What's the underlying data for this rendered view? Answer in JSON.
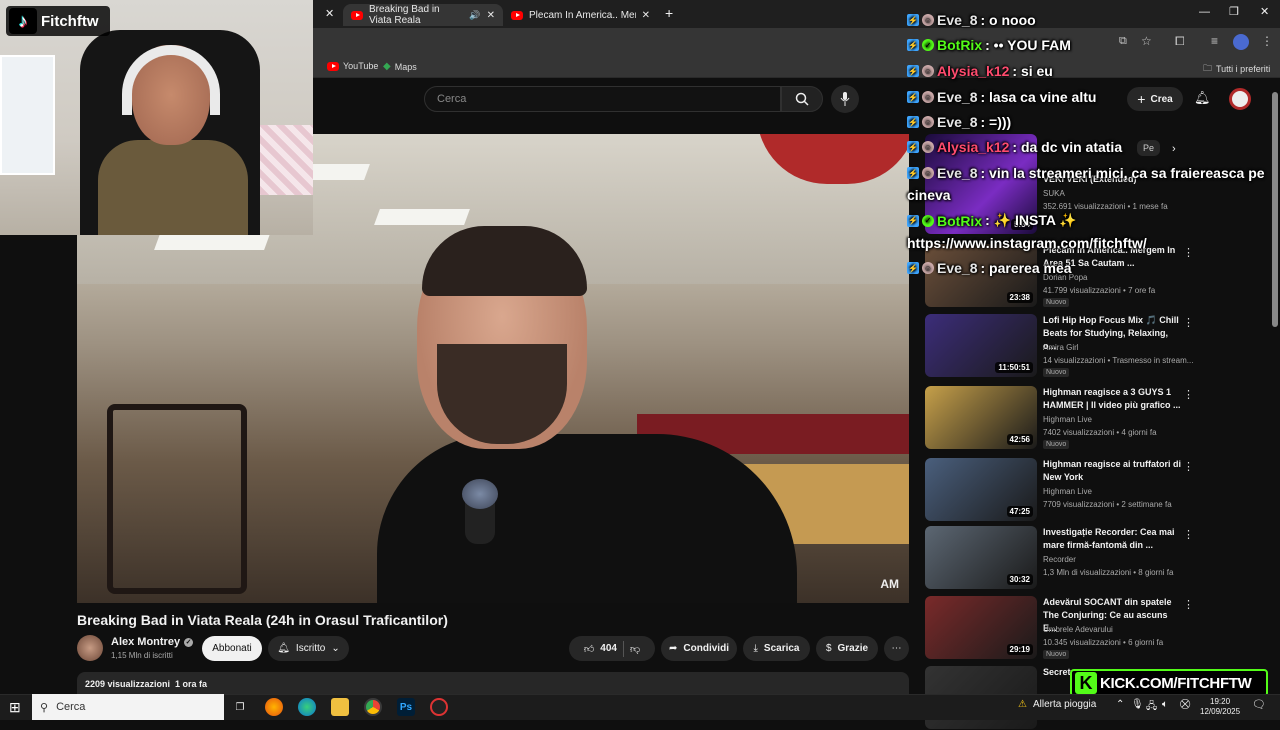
{
  "browser": {
    "tabs": [
      {
        "label": "Breaking Bad in Viata Reala"
      },
      {
        "label": "Plecam In America.. Mergem In"
      }
    ],
    "bookmarks": [
      {
        "label": "YouTube"
      },
      {
        "label": "Maps"
      }
    ],
    "bookmarks_right": "Tutti i preferiti"
  },
  "youtube": {
    "search_placeholder": "Cerca",
    "create_label": "Crea"
  },
  "overlay": {
    "streamer_name": "Fitchftw",
    "kick_url": "KICK.COM/FITCHFTW"
  },
  "video": {
    "watermark": "AM",
    "title": "Breaking Bad in Viata Reala (24h in Orasul Traficantilor)",
    "channel": "Alex Montrey",
    "subscribers": "1,15 Mln di iscritti",
    "subscribe_label": "Abbonati",
    "subscribed_label": "Iscritto",
    "likes": "404",
    "share_label": "Condividi",
    "download_label": "Scarica",
    "thanks_label": "Grazie",
    "views_line": "2209 visualizzazioni  1 ora fa"
  },
  "chat": [
    {
      "user": "Eve_8",
      "message": ": o nooo",
      "color": "#e6e6e6"
    },
    {
      "user": "BotRix",
      "message": ": •• YOU FAM",
      "color": "#53fc18"
    },
    {
      "user": "Alysia_k12",
      "message": ": si eu",
      "color": "#ff4b6e"
    },
    {
      "user": "Eve_8",
      "message": ": lasa ca vine altu",
      "color": "#e6e6e6"
    },
    {
      "user": "Eve_8",
      "message": ": =)))",
      "color": "#e6e6e6"
    },
    {
      "user": "Alysia_k12",
      "message": ": da dc vin atatia",
      "color": "#ff4b6e"
    },
    {
      "user": "Eve_8",
      "message": ": vin la streameri mici, ca sa fraiereasca pe",
      "color": "#e6e6e6"
    },
    {
      "user": "",
      "message": "cineva",
      "color": "#fff"
    },
    {
      "user": "BotRix",
      "message": ": ✨ INSTA ✨",
      "color": "#53fc18"
    },
    {
      "user": "",
      "message": "https://www.instagram.com/fitchftw/",
      "color": "#fff"
    },
    {
      "user": "Eve_8",
      "message": ": parerea mea",
      "color": "#e6e6e6"
    }
  ],
  "recommendations": [
    {
      "title": "Plecam In America.. Mergem In Area 51 Sa Cautam ...",
      "channel": "Dorian Popa",
      "meta": "41.799 visualizzazioni • 7 ore fa",
      "badge": "Nuovo",
      "duration": "23:38"
    },
    {
      "title": "Lofi Hip Hop Focus Mix 🎵 Chill Beats for Studying, Relaxing, o...",
      "channel": "Amira Girl",
      "meta": "14 visualizzazioni • Trasmesso in stream...",
      "badge": "Nuovo",
      "duration": "11:50:51"
    },
    {
      "title": "Highman reagisce a 3 GUYS 1 HAMMER | Il video più grafico ...",
      "channel": "Highman Live",
      "meta": "7402 visualizzazioni • 4 giorni fa",
      "badge": "Nuovo",
      "duration": "42:56"
    },
    {
      "title": "Highman reagisce ai truffatori di New York",
      "channel": "Highman Live",
      "meta": "7709 visualizzazioni • 2 settimane fa",
      "badge": "",
      "duration": "47:25"
    },
    {
      "title": "Investigație Recorder: Cea mai mare firmă-fantomă din ...",
      "channel": "Recorder",
      "meta": "1,3 Mln di visualizzazioni • 8 giorni fa",
      "badge": "",
      "duration": "30:32"
    },
    {
      "title": "Adevărul SOCANT din spatele The Conjuring: Ce au ascuns E...",
      "channel": "Umbrele Adevarului",
      "meta": "10.345 visualizzazioni • 6 giorni fa",
      "badge": "Nuovo",
      "duration": "29:19"
    },
    {
      "title": "Secret...",
      "channel": "",
      "meta": "",
      "badge": "",
      "duration": ""
    }
  ],
  "partial_top": {
    "title": "VEKI VEKI (Extended)",
    "channel": "SUKA",
    "meta": "352.691 visualizzazioni • 1 mese fa",
    "duration": "5:34",
    "chip": "Pe"
  },
  "thumb_colors": [
    "#6b4f3a",
    "#3c2d7a",
    "#c6a04a",
    "#4a5f7d",
    "#5c6773",
    "#7a2a2a",
    "#333"
  ],
  "taskbar": {
    "search_placeholder": "Cerca",
    "weather": "Allerta pioggia",
    "time": "19:20",
    "date": "12/09/2025"
  }
}
